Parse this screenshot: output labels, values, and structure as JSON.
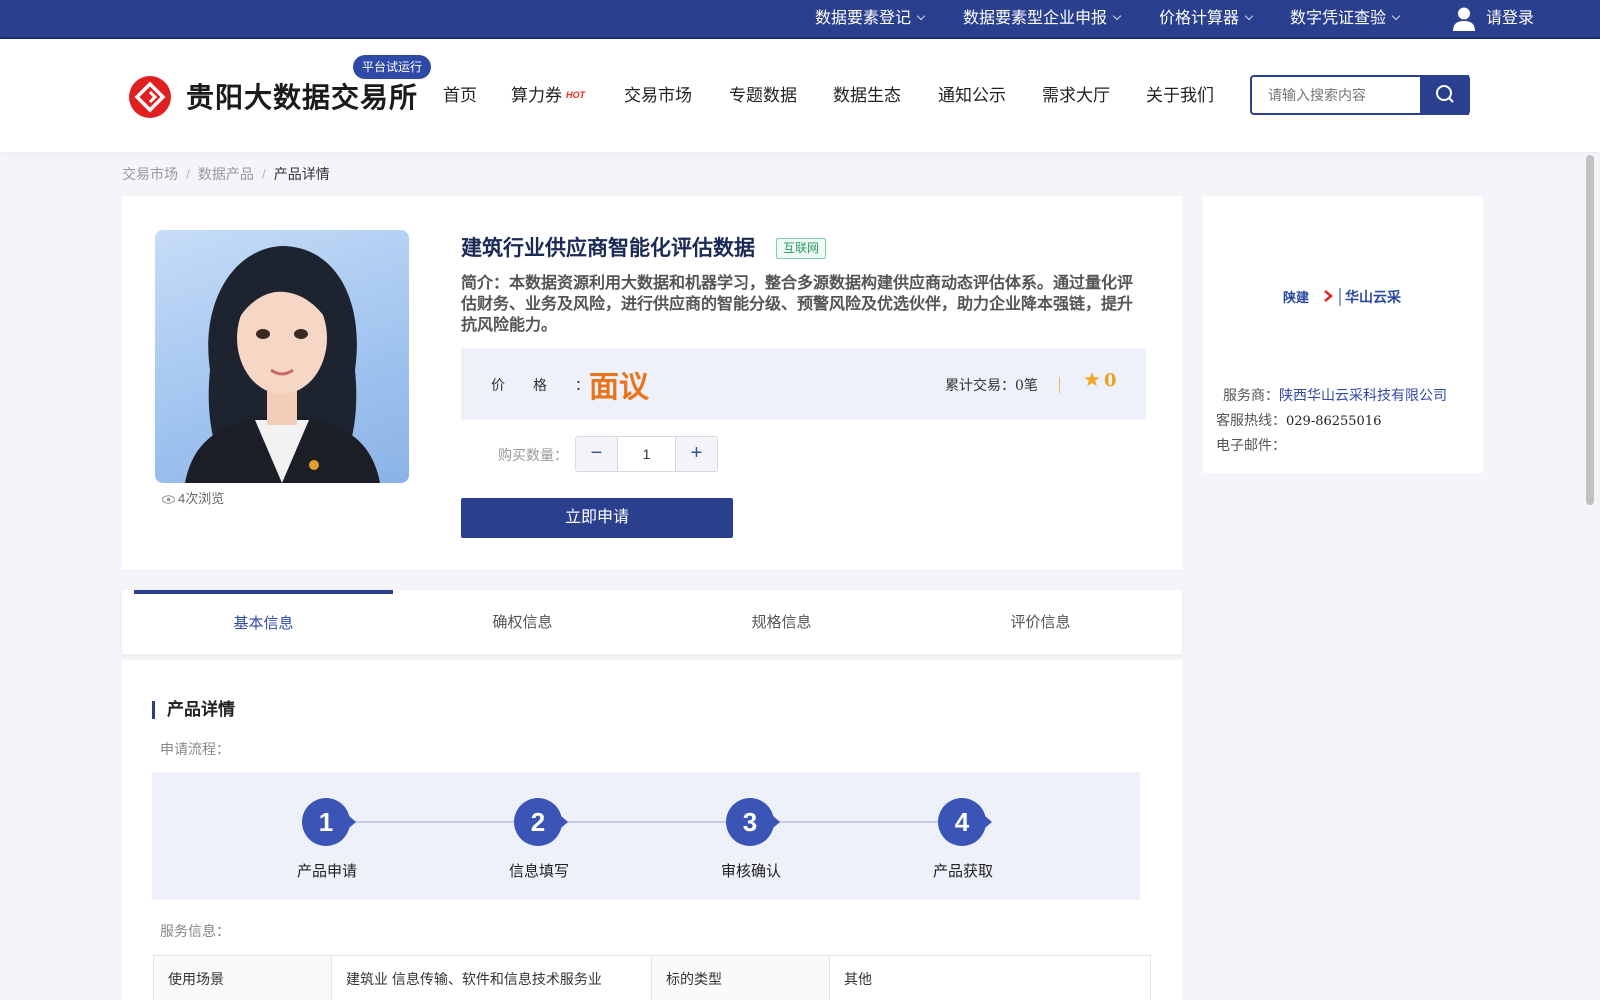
{
  "topbar": {
    "links": [
      "数据要素登记",
      "数据要素型企业申报",
      "价格计算器",
      "数字凭证查验"
    ],
    "login_label": "请登录"
  },
  "header": {
    "site_name": "贵阳大数据交易所",
    "trial_badge": "平台试运行",
    "nav": [
      "首页",
      "算力券",
      "交易市场",
      "专题数据",
      "数据生态",
      "通知公示",
      "需求大厅",
      "关于我们"
    ],
    "hot_label": "HOT",
    "search_placeholder": "请输入搜索内容"
  },
  "breadcrumb": [
    "交易市场",
    "数据产品",
    "产品详情"
  ],
  "product": {
    "title": "建筑行业供应商智能化评估数据",
    "tag": "互联网",
    "intro": "简介：本数据资源利用大数据和机器学习，整合多源数据构建供应商动态评估体系。通过量化评估财务、业务及风险，进行供应商的智能分级、预警风险及优选伙伴，助力企业降本强链，提升抗风险能力。",
    "views": "4次浏览",
    "price_label": "价格：",
    "price_value": "面议",
    "trade_count": "累计交易：0笔",
    "rating": "0",
    "qty_label": "购买数量：",
    "qty_minus": "−",
    "qty_value": "1",
    "qty_plus": "+",
    "apply_label": "立即申请"
  },
  "provider": {
    "logo_text_left": "陕建",
    "logo_text_right": "华山云采",
    "service_label": "服务商：",
    "service_value": "陕西华山云采科技有限公司",
    "hotline_label": "客服热线：",
    "hotline_value": "029-86255016",
    "email_label": "电子邮件："
  },
  "tabs": [
    "基本信息",
    "确权信息",
    "规格信息",
    "评价信息"
  ],
  "detail": {
    "section_title": "产品详情",
    "flow_label": "申请流程：",
    "steps": [
      {
        "num": "1",
        "label": "产品申请"
      },
      {
        "num": "2",
        "label": "信息填写"
      },
      {
        "num": "3",
        "label": "审核确认"
      },
      {
        "num": "4",
        "label": "产品获取"
      }
    ],
    "service_info_label": "服务信息：",
    "table": [
      [
        "使用场景",
        "建筑业 信息传输、软件和信息技术服务业",
        "标的类型",
        "其他"
      ]
    ]
  },
  "colors": {
    "brand": "#2b3f8f",
    "price": "#e8751e",
    "rating": "#e8a21e",
    "tag": "#2e9a63"
  }
}
